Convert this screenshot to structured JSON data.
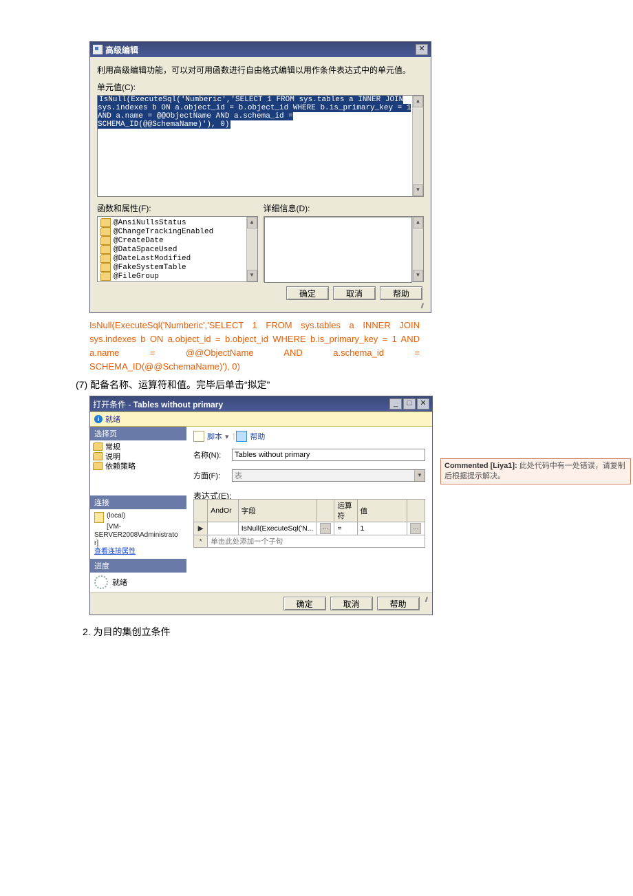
{
  "dialog1": {
    "title": "高级编辑",
    "intro": "利用高级编辑功能，可以对可用函数进行自由格式编辑以用作条件表达式中的单元值。",
    "cell_label": "单元值(C):",
    "code_text": "IsNull(ExecuteSql('Numberic','SELECT 1 FROM sys.tables a INNER JOIN sys.indexes b ON a.object_id = b.object_id WHERE b.is_primary_key = 1 AND a.name = @@ObjectName AND a.schema_id = SCHEMA_ID(@@SchemaName)'), 0)",
    "func_label": "函数和属性(F):",
    "detail_label": "详细信息(D):",
    "props": [
      "@AnsiNullsStatus",
      "@ChangeTrackingEnabled",
      "@CreateDate",
      "@DataSpaceUsed",
      "@DateLastModified",
      "@FakeSystemTable",
      "@FileGroup"
    ],
    "buttons": {
      "ok": "确定",
      "cancel": "取消",
      "help": "帮助"
    }
  },
  "sql_text": "IsNull(ExecuteSql('Numberic','SELECT 1 FROM sys.tables a INNER JOIN sys.indexes b ON a.object_id = b.object_id WHERE b.is_primary_key = 1 AND a.name = @@ObjectName AND a.schema_id = SCHEMA_ID(@@SchemaName)'), 0)",
  "step7": "(7)  配备名称、运算符和值。完毕后单击“拟定”",
  "dialog2": {
    "title_prefix": "打开条件 - ",
    "title_suffix": "Tables without primary",
    "statusbar": "就绪",
    "nav_header": "选择页",
    "nav_items": [
      "常规",
      "说明",
      "依赖策略"
    ],
    "conn_header": "连接",
    "conn_local": "(local)",
    "conn_user": "[VM-SERVER2008\\Administrato r]",
    "conn_link": "查看连接属性",
    "prog_header": "进度",
    "prog_status": "就绪",
    "tool_script": "脚本",
    "tool_help": "帮助",
    "name_label": "名称(N):",
    "name_value": "Tables without primary",
    "facet_label": "方面(F):",
    "facet_value": "表",
    "expr_label": "表达式(E):",
    "grid_headers": {
      "andor": "AndOr",
      "field": "字段",
      "op": "运算符",
      "val": "值"
    },
    "grid_row": {
      "field": "IsNull(ExecuteSql('N...",
      "ellipsis": "...",
      "op": "=",
      "val": "1"
    },
    "grid_new_hint": "单击此处添加一个子句",
    "buttons": {
      "ok": "确定",
      "cancel": "取消",
      "help": "帮助"
    }
  },
  "comment": {
    "author": "Commented [Liya1]:",
    "text": " 此处代码中有一处错误，请复制后根据提示解决。"
  },
  "step2": "2.   为目的集创立条件"
}
